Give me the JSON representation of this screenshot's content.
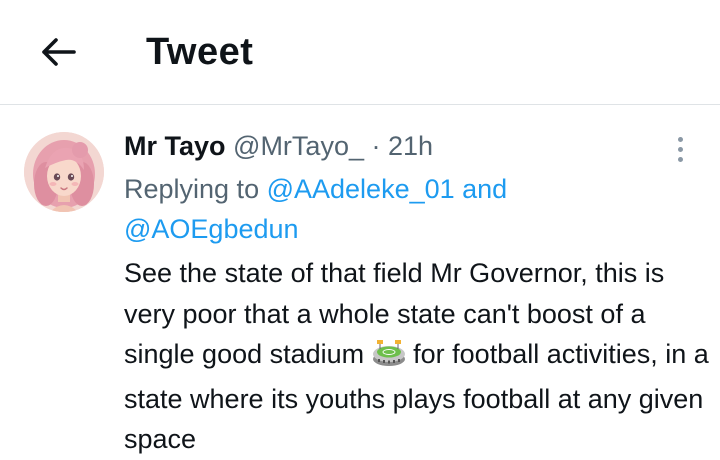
{
  "header": {
    "back_icon": "arrow-left-icon",
    "title": "Tweet"
  },
  "tweet": {
    "display_name": "Mr Tayo",
    "handle": "@MrTayo_",
    "separator": "·",
    "time": "21h",
    "more_icon": "more-vertical-icon",
    "replying_prefix": "Replying to ",
    "mention_1": "@AAdeleke_01",
    "conjunction": " and",
    "mention_2": "@AOEgbedun",
    "text_part_1": "See the state of that field Mr Governor, this is very poor that a whole state can't boost of a single good stadium ",
    "emoji_icon": "stadium-icon",
    "text_part_2": " for football activities, in a state where its youths plays football at any given space"
  },
  "colors": {
    "text_primary": "#0f1419",
    "text_secondary": "#536471",
    "link": "#1d9bf0",
    "divider": "#dfe3e6"
  }
}
